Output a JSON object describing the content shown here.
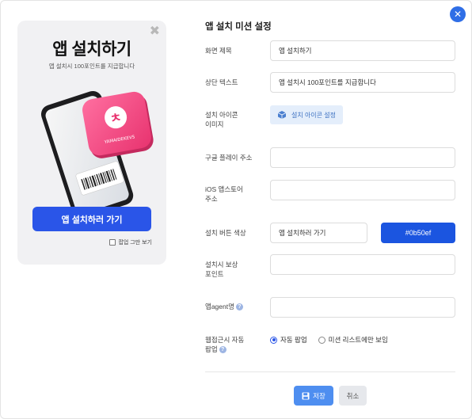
{
  "preview": {
    "close_icon": "close-x-icon",
    "title": "앱 설치하기",
    "subtitle": "앱 설치시 100포인트를 지급합니다",
    "badge_text": "YAMAIDEKEVS",
    "install_button_label": "앱 설치하러 가기",
    "hide_popup_label": "팝업 그만 보기"
  },
  "form": {
    "title": "앱 설치 미션 설정",
    "screen_title_label": "화면 제목",
    "screen_title_value": "앱 설치하기",
    "top_text_label": "상단 텍스트",
    "top_text_value": "앱 설치시 100포인트를 지급합니다",
    "install_icon_label_line1": "설치 아이콘",
    "install_icon_label_line2": "이미지",
    "install_icon_button_label": "설치 아이콘 설정",
    "google_play_label": "구글 플레이 주소",
    "google_play_value": "",
    "ios_label_line1": "iOS 앱스토어",
    "ios_label_line2": "주소",
    "ios_value": "",
    "button_color_label": "설치 버튼 색상",
    "button_text_value": "앱 설치하러 가기",
    "button_color_value": "#0b50ef",
    "reward_label_line1": "설치시 보상",
    "reward_label_line2": "포인트",
    "reward_value": "",
    "agent_label": "앱agent명",
    "agent_value": "",
    "auto_popup_label_line1": "웹접근시 자동",
    "auto_popup_label_line2": "팝업",
    "radio_auto": "자동 팝업",
    "radio_list_only": "미션 리스트에만 보임",
    "selected_radio": "자동 팝업",
    "save_label": "저장",
    "cancel_label": "취소"
  },
  "colors": {
    "accent": "#2a55e8",
    "install_button": "#0b50ef",
    "save_button": "#4e8ef0",
    "badge_pink": "#f0508a"
  }
}
